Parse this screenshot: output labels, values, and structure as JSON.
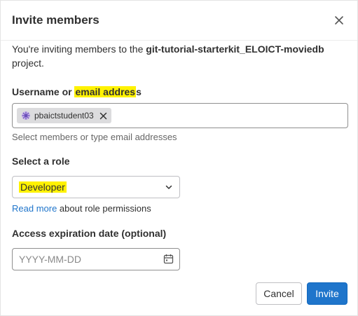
{
  "modal": {
    "title": "Invite members",
    "intro_prefix": "You're inviting members to the ",
    "project_name": "git-tutorial-starterkit_ELOICT-moviedb",
    "intro_suffix": " project."
  },
  "username_field": {
    "label_prefix": "Username or ",
    "label_highlight": "email addres",
    "label_suffix": "s",
    "tokens": [
      "pbaictstudent03"
    ],
    "help": "Select members or type email addresses"
  },
  "role_field": {
    "label": "Select a role",
    "selected": "Developer",
    "read_more_link": "Read more",
    "read_more_suffix": " about role permissions"
  },
  "expiration_field": {
    "label": "Access expiration date (optional)",
    "placeholder": "YYYY-MM-DD"
  },
  "buttons": {
    "cancel": "Cancel",
    "invite": "Invite"
  },
  "colors": {
    "primary": "#1f75cb",
    "highlight": "#fff200",
    "chip_bg": "#dcdcde"
  },
  "icons": {
    "close": "close-icon",
    "avatar": "avatar-icon",
    "chip_remove": "remove-icon",
    "select": "chevron-down-icon",
    "date": "calendar-icon"
  }
}
